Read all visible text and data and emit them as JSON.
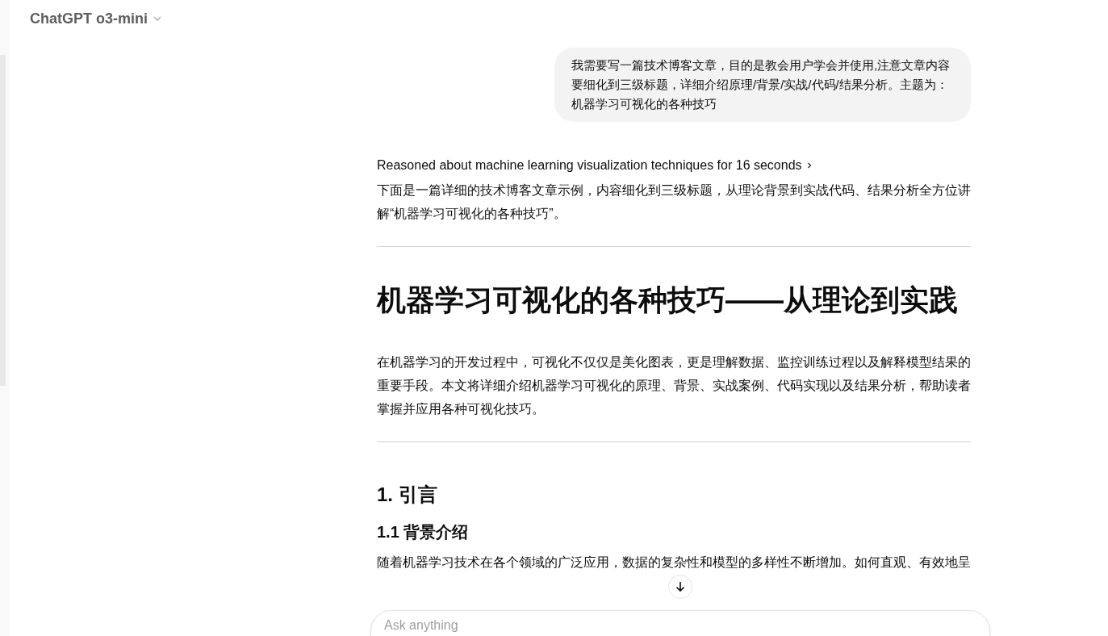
{
  "header": {
    "model_title": "ChatGPT o3-mini"
  },
  "user_message": "我需要写一篇技术博客文章，目的是教会用户学会并使用,注意文章内容要细化到三级标题，详细介绍原理/背景/实战/代码/结果分析。主题为：机器学习可视化的各种技巧",
  "response": {
    "reasoning": "Reasoned about machine learning visualization techniques for 16 seconds",
    "blocks": [
      {
        "kind": "p",
        "text": "下面是一篇详细的技术博客文章示例，内容细化到三级标题，从理论背景到实战代码、结果分析全方位讲解“机器学习可视化的各种技巧”。"
      },
      {
        "kind": "hr"
      },
      {
        "kind": "h1",
        "text": "机器学习可视化的各种技巧——从理论到实践"
      },
      {
        "kind": "p",
        "text": "在机器学习的开发过程中，可视化不仅仅是美化图表，更是理解数据、监控训练过程以及解释模型结果的重要手段。本文将详细介绍机器学习可视化的原理、背景、实战案例、代码实现以及结果分析，帮助读者掌握并应用各种可视化技巧。"
      },
      {
        "kind": "hr"
      },
      {
        "kind": "h2",
        "text": "1. 引言"
      },
      {
        "kind": "h3",
        "text": "1.1 背景介绍"
      },
      {
        "kind": "p",
        "text": "随着机器学习技术在各个领域的广泛应用，数据的复杂性和模型的多样性不断增加。如何直观、有效地呈"
      }
    ]
  },
  "composer": {
    "placeholder": "Ask anything"
  }
}
